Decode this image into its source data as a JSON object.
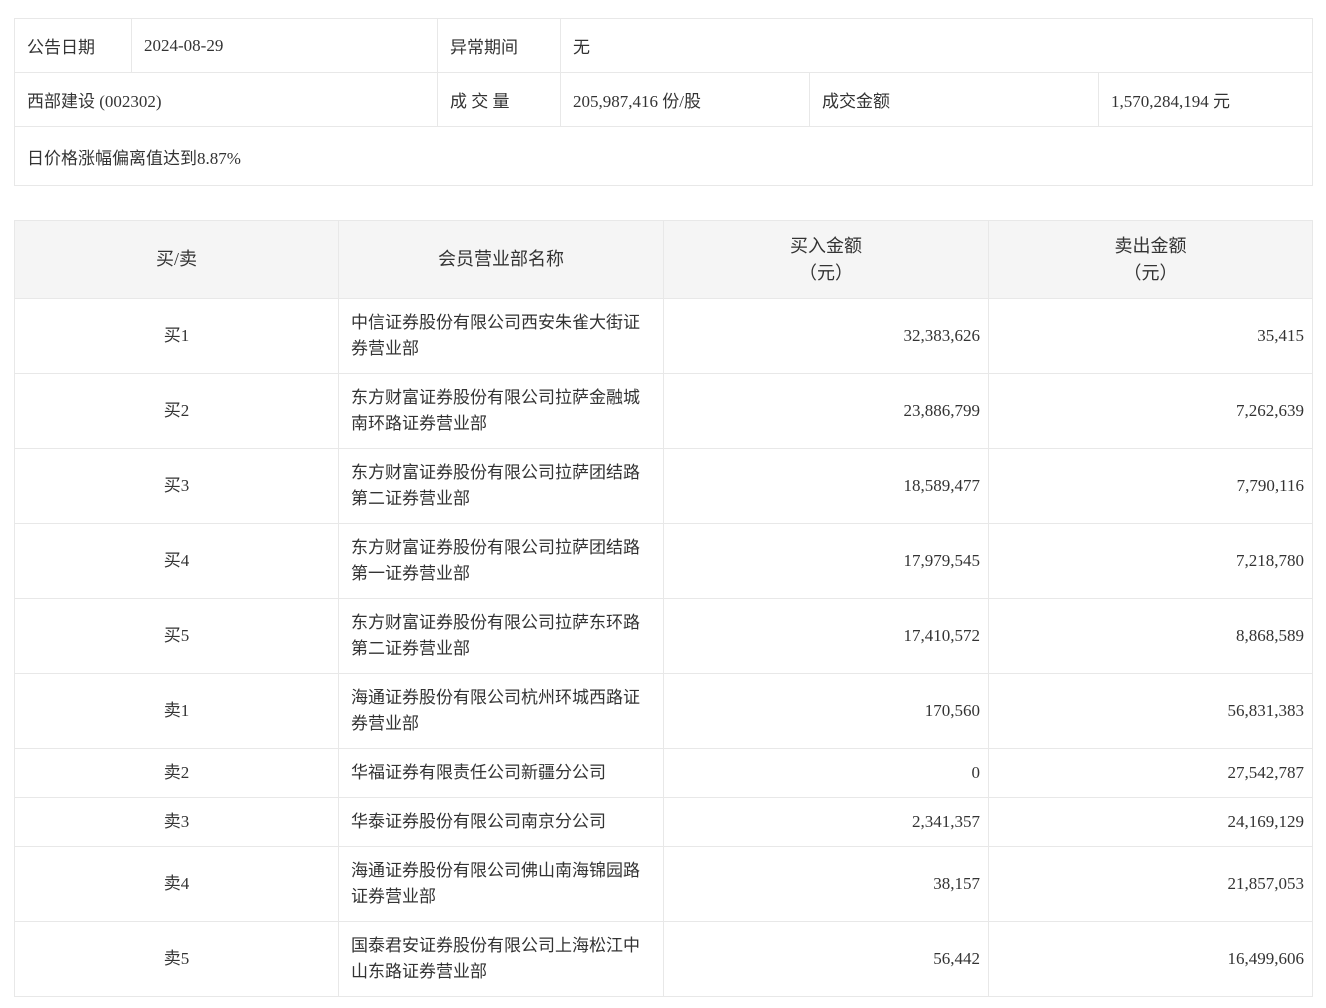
{
  "summary": {
    "announce_date_label": "公告日期",
    "announce_date_value": "2024-08-29",
    "abnormal_period_label": "异常期间",
    "abnormal_period_value": "无",
    "stock_name": "西部建设 (002302)",
    "volume_label": "成 交 量",
    "volume_value": "205,987,416 份/股",
    "turnover_label": "成交金额",
    "turnover_value": "1,570,284,194 元",
    "deviation_note": "日价格涨幅偏离值达到8.87%"
  },
  "rank_table": {
    "col_side": "买/卖",
    "col_branch": "会员营业部名称",
    "col_buy": "买入金额",
    "col_sell": "卖出金额",
    "unit": "（元）",
    "rows": [
      {
        "side": "买1",
        "branch": "中信证券股份有限公司西安朱雀大街证券营业部",
        "buy": "32,383,626",
        "sell": "35,415"
      },
      {
        "side": "买2",
        "branch": "东方财富证券股份有限公司拉萨金融城南环路证券营业部",
        "buy": "23,886,799",
        "sell": "7,262,639"
      },
      {
        "side": "买3",
        "branch": "东方财富证券股份有限公司拉萨团结路第二证券营业部",
        "buy": "18,589,477",
        "sell": "7,790,116"
      },
      {
        "side": "买4",
        "branch": "东方财富证券股份有限公司拉萨团结路第一证券营业部",
        "buy": "17,979,545",
        "sell": "7,218,780"
      },
      {
        "side": "买5",
        "branch": "东方财富证券股份有限公司拉萨东环路第二证券营业部",
        "buy": "17,410,572",
        "sell": "8,868,589"
      },
      {
        "side": "卖1",
        "branch": "海通证券股份有限公司杭州环城西路证券营业部",
        "buy": "170,560",
        "sell": "56,831,383"
      },
      {
        "side": "卖2",
        "branch": "华福证券有限责任公司新疆分公司",
        "buy": "0",
        "sell": "27,542,787"
      },
      {
        "side": "卖3",
        "branch": "华泰证券股份有限公司南京分公司",
        "buy": "2,341,357",
        "sell": "24,169,129"
      },
      {
        "side": "卖4",
        "branch": "海通证券股份有限公司佛山南海锦园路证券营业部",
        "buy": "38,157",
        "sell": "21,857,053"
      },
      {
        "side": "卖5",
        "branch": "国泰君安证券股份有限公司上海松江中山东路证券营业部",
        "buy": "56,442",
        "sell": "16,499,606"
      }
    ]
  },
  "colors": {
    "border": "#e8e8e8",
    "header_bg": "#f5f5f5",
    "text": "#333333"
  }
}
